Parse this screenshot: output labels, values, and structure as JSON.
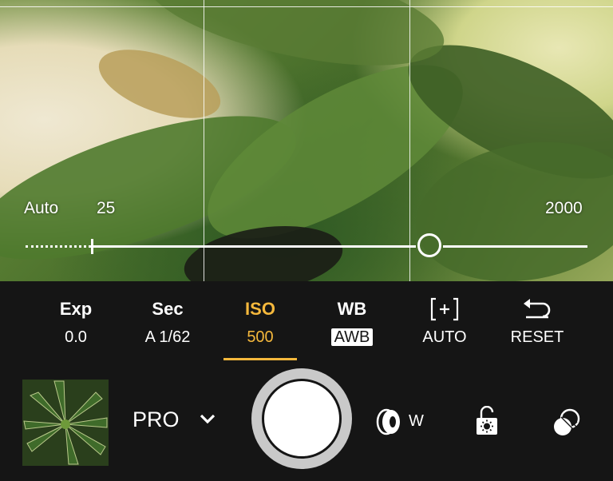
{
  "viewfinder": {
    "iso_slider": {
      "auto_label": "Auto",
      "min_label": "25",
      "max_label": "2000",
      "level": 0.68
    }
  },
  "settings": [
    {
      "name": "Exp",
      "value": "0.0"
    },
    {
      "name": "Sec",
      "value": "A 1/62"
    },
    {
      "name": "ISO",
      "value": "500"
    },
    {
      "name": "WB",
      "value": "AWB"
    },
    {
      "name": "",
      "value": "AUTO"
    },
    {
      "name": "",
      "value": "RESET"
    }
  ],
  "active_setting": "ISO",
  "bottom_bar": {
    "mode_label": "PRO",
    "lens_label": "W"
  },
  "colors": {
    "accent": "#f5b83c",
    "background": "#151515"
  },
  "icons": {
    "focus": "focus-bracket-icon",
    "reset": "reset-arrow-icon",
    "mode_dropdown": "chevron-down-icon",
    "lens": "lens-icon",
    "ae_lock": "lock-sun-icon",
    "filter": "filter-icon"
  }
}
